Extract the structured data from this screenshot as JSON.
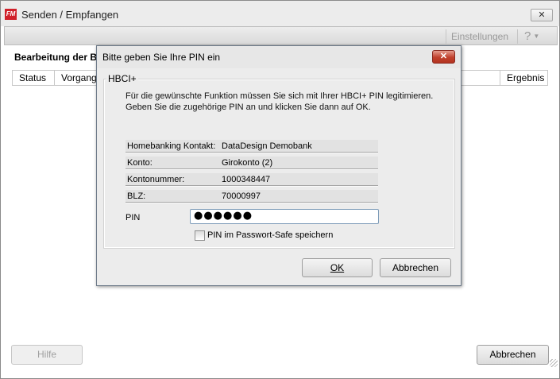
{
  "main_window": {
    "logo_text": "FM",
    "title": "Senden / Empfangen",
    "close_glyph": "✕",
    "toolbar": {
      "settings_label": "Einstellungen",
      "help_label": "?",
      "help_arrow": "▼"
    },
    "section_heading": "Bearbeitung der Ba",
    "table": {
      "columns": [
        "Status",
        "Vorgang",
        "Ergebnis"
      ]
    },
    "help_button_label": "Hilfe",
    "cancel_button_label": "Abbrechen"
  },
  "pin_dialog": {
    "title": "Bitte geben Sie Ihre PIN ein",
    "close_glyph": "✕",
    "group_label": "HBCI+",
    "message_line1": "Für die gewünschte Funktion müssen Sie sich mit Ihrer HBCI+ PIN legitimieren.",
    "message_line2": "Geben Sie die zugehörige PIN an und klicken Sie dann auf OK.",
    "rows": [
      {
        "label": "Homebanking Kontakt:",
        "value": "DataDesign Demobank"
      },
      {
        "label": "Konto:",
        "value": "Girokonto (2)"
      },
      {
        "label": "Kontonummer:",
        "value": "1000348447"
      },
      {
        "label": "BLZ:",
        "value": "70000997"
      }
    ],
    "pin_label": "PIN",
    "pin_value": "●●●●●●",
    "save_checkbox_label": "PIN im Passwort-Safe speichern",
    "save_checked": false,
    "ok_label": "OK",
    "cancel_label": "Abbrechen"
  },
  "colors": {
    "logo_red": "#d0202a",
    "close_red": "#c0402c",
    "window_bg": "#ececec"
  }
}
